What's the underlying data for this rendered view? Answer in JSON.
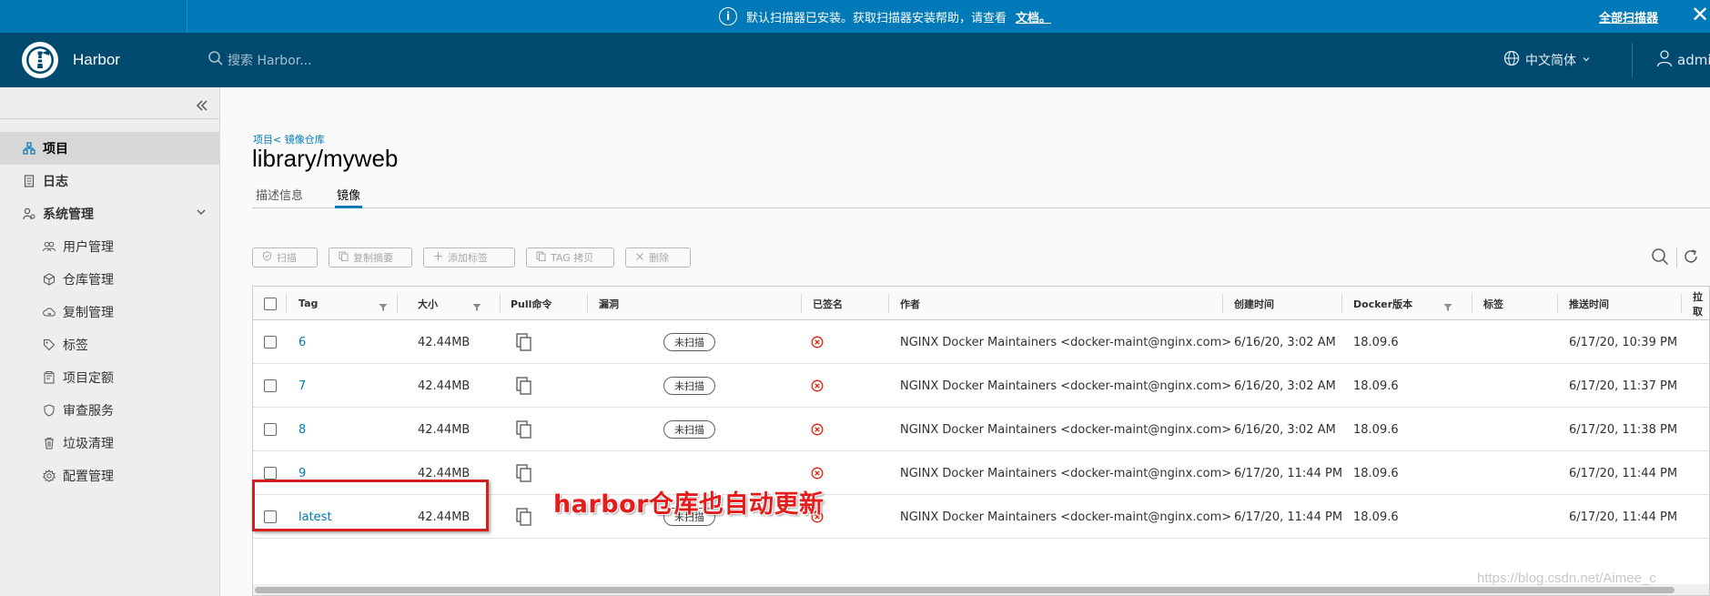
{
  "banner": {
    "message": "默认扫描器已安装。获取扫描器安装帮助，请查看",
    "doc_link": "文档。",
    "all_scanners": "全部扫描器",
    "close": "✕"
  },
  "header": {
    "brand": "Harbor",
    "search_placeholder": "搜索 Harbor...",
    "language": "中文简体",
    "user": "admin"
  },
  "sidebar": {
    "items": [
      {
        "label": "项目",
        "icon": "project-icon"
      },
      {
        "label": "日志",
        "icon": "log-icon"
      },
      {
        "label": "系统管理",
        "icon": "system-admin-icon"
      },
      {
        "label": "用户管理",
        "icon": "users-icon"
      },
      {
        "label": "仓库管理",
        "icon": "registry-icon"
      },
      {
        "label": "复制管理",
        "icon": "replication-icon"
      },
      {
        "label": "标签",
        "icon": "tag-icon"
      },
      {
        "label": "项目定额",
        "icon": "quota-icon"
      },
      {
        "label": "审查服务",
        "icon": "shield-icon"
      },
      {
        "label": "垃圾清理",
        "icon": "trash-icon"
      },
      {
        "label": "配置管理",
        "icon": "gear-icon"
      }
    ]
  },
  "breadcrumb": "项目< 镜像仓库",
  "page_title": "library/myweb",
  "tabs": [
    {
      "label": "描述信息"
    },
    {
      "label": "镜像",
      "active": true
    }
  ],
  "toolbar": {
    "scan": "扫描",
    "copy_digest": "复制摘要",
    "add_label": "添加标签",
    "tag_copy": "TAG 拷贝",
    "delete": "删除"
  },
  "table": {
    "columns": [
      "Tag",
      "大小",
      "Pull命令",
      "漏洞",
      "已签名",
      "作者",
      "创建时间",
      "Docker版本",
      "标签",
      "推送时间",
      "拉取"
    ],
    "rows": [
      {
        "tag": "6",
        "size": "42.44MB",
        "vuln": "未扫描",
        "author": "NGINX Docker Maintainers <docker-maint@nginx.com>",
        "created": "6/16/20, 3:02 AM",
        "docker_version": "18.09.6",
        "push_time": "6/17/20, 10:39 PM"
      },
      {
        "tag": "7",
        "size": "42.44MB",
        "vuln": "未扫描",
        "author": "NGINX Docker Maintainers <docker-maint@nginx.com>",
        "created": "6/16/20, 3:02 AM",
        "docker_version": "18.09.6",
        "push_time": "6/17/20, 11:37 PM"
      },
      {
        "tag": "8",
        "size": "42.44MB",
        "vuln": "未扫描",
        "author": "NGINX Docker Maintainers <docker-maint@nginx.com>",
        "created": "6/16/20, 3:02 AM",
        "docker_version": "18.09.6",
        "push_time": "6/17/20, 11:38 PM"
      },
      {
        "tag": "9",
        "size": "42.44MB",
        "vuln": "",
        "author": "NGINX Docker Maintainers <docker-maint@nginx.com>",
        "created": "6/17/20, 11:44 PM",
        "docker_version": "18.09.6",
        "push_time": "6/17/20, 11:44 PM"
      },
      {
        "tag": "latest",
        "size": "42.44MB",
        "vuln": "未扫描",
        "author": "NGINX Docker Maintainers <docker-maint@nginx.com>",
        "created": "6/17/20, 11:44 PM",
        "docker_version": "18.09.6",
        "push_time": "6/17/20, 11:44 PM"
      }
    ]
  },
  "annotation": "harbor仓库也自动更新",
  "watermark": "https://blog.csdn.net/Aimee_c",
  "colors": {
    "banner": "#0079b8",
    "header": "#004a70",
    "link": "#0079b8",
    "annotation": "#e51c1c"
  }
}
